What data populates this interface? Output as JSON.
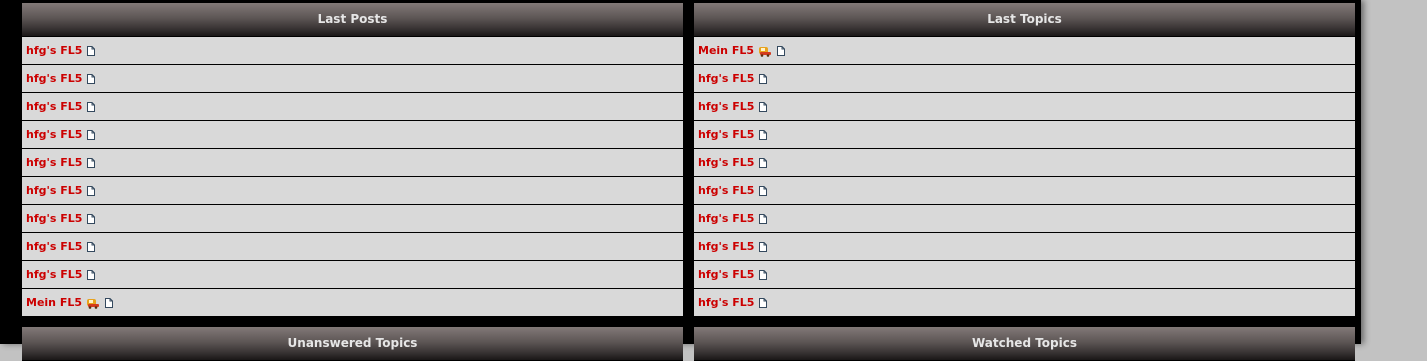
{
  "last_posts": {
    "title": "Last Posts",
    "rows": [
      {
        "label": "hfg's FL5",
        "emoji": false
      },
      {
        "label": "hfg's FL5",
        "emoji": false
      },
      {
        "label": "hfg's FL5",
        "emoji": false
      },
      {
        "label": "hfg's FL5",
        "emoji": false
      },
      {
        "label": "hfg's FL5",
        "emoji": false
      },
      {
        "label": "hfg's FL5",
        "emoji": false
      },
      {
        "label": "hfg's FL5",
        "emoji": false
      },
      {
        "label": "hfg's FL5",
        "emoji": false
      },
      {
        "label": "hfg's FL5",
        "emoji": false
      },
      {
        "label": "Mein FL5",
        "emoji": true
      }
    ]
  },
  "last_topics": {
    "title": "Last Topics",
    "rows": [
      {
        "label": "Mein FL5",
        "emoji": true
      },
      {
        "label": "hfg's FL5",
        "emoji": false
      },
      {
        "label": "hfg's FL5",
        "emoji": false
      },
      {
        "label": "hfg's FL5",
        "emoji": false
      },
      {
        "label": "hfg's FL5",
        "emoji": false
      },
      {
        "label": "hfg's FL5",
        "emoji": false
      },
      {
        "label": "hfg's FL5",
        "emoji": false
      },
      {
        "label": "hfg's FL5",
        "emoji": false
      },
      {
        "label": "hfg's FL5",
        "emoji": false
      },
      {
        "label": "hfg's FL5",
        "emoji": false
      }
    ]
  },
  "unanswered_topics": {
    "title": "Unanswered Topics"
  },
  "watched_topics": {
    "title": "Watched Topics"
  },
  "colors": {
    "link": "#cc0000",
    "row_bg": "#d9d9d9",
    "frame": "#000000",
    "header_text": "#e6e6e6",
    "page_bg": "#c2c2c2"
  },
  "icons": {
    "page": "page-icon",
    "emoji": "car-emoji-icon"
  }
}
